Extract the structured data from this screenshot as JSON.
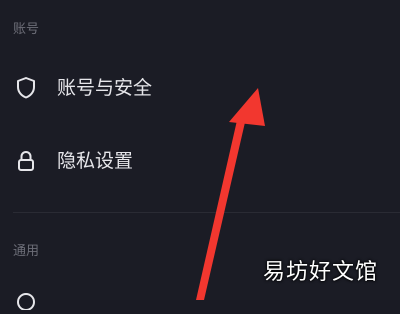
{
  "sections": [
    {
      "header": "账号",
      "items": [
        {
          "label": "账号与安全",
          "icon": "shield-icon"
        },
        {
          "label": "隐私设置",
          "icon": "lock-icon"
        }
      ]
    },
    {
      "header": "通用",
      "items": []
    }
  ],
  "watermark": "易坊好文馆",
  "colors": {
    "background": "#1b1c25",
    "text": "#e6e6ea",
    "header": "#6d6e78",
    "arrow": "#f2372f"
  }
}
